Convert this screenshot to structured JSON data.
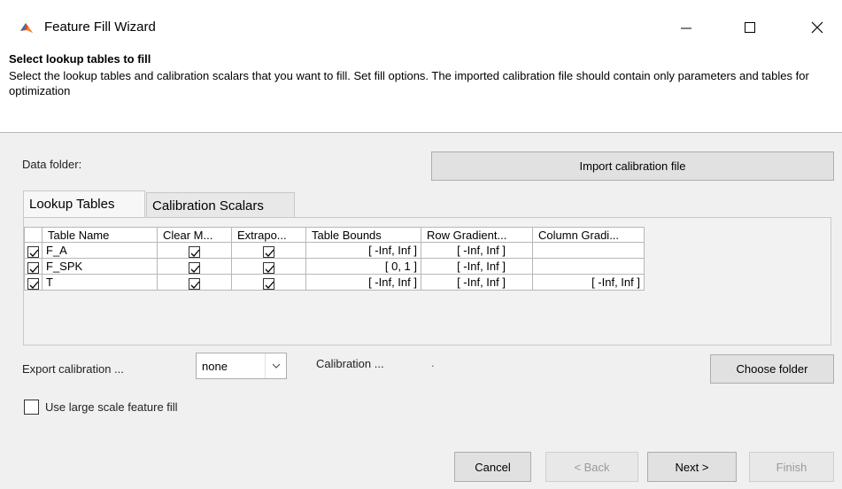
{
  "window": {
    "title": "Feature Fill Wizard"
  },
  "header": {
    "title": "Select lookup tables to fill",
    "description": "Select the lookup tables and calibration scalars that you want to fill. Set fill options. The imported calibration file should contain only parameters and tables for optimization"
  },
  "data_folder_label": "Data folder:",
  "import_button": "Import calibration file",
  "tabs": [
    {
      "label": "Lookup Tables",
      "active": true
    },
    {
      "label": "Calibration Scalars",
      "active": false
    }
  ],
  "table": {
    "columns": [
      "Table Name",
      "Clear M...",
      "Extrapo...",
      "Table Bounds",
      "Row Gradient...",
      "Column Gradi..."
    ],
    "rows": [
      {
        "selected": true,
        "name": "F_A",
        "clear": true,
        "extrapolate": true,
        "bounds": "[ -Inf, Inf ]",
        "row_gradient": "[ -Inf, Inf ]",
        "column_gradient": ""
      },
      {
        "selected": true,
        "name": "F_SPK",
        "clear": true,
        "extrapolate": true,
        "bounds": "[ 0, 1 ]",
        "row_gradient": "[ -Inf, Inf ]",
        "column_gradient": ""
      },
      {
        "selected": true,
        "name": "T",
        "clear": true,
        "extrapolate": true,
        "bounds": "[ -Inf, Inf ]",
        "row_gradient": "[ -Inf, Inf ]",
        "column_gradient": "[ -Inf, Inf ]"
      }
    ]
  },
  "export_label": "Export calibration ...",
  "export_select": {
    "value": "none"
  },
  "calibration_label": "Calibration ...",
  "calibration_value": ".",
  "choose_folder_button": "Choose folder",
  "large_scale": {
    "label": "Use large scale feature fill",
    "checked": false
  },
  "footer": {
    "cancel": "Cancel",
    "back": "< Back",
    "next": "Next >",
    "finish": "Finish"
  },
  "colors": {
    "accent": "#d9531e",
    "panel": "#f0f0f0"
  }
}
